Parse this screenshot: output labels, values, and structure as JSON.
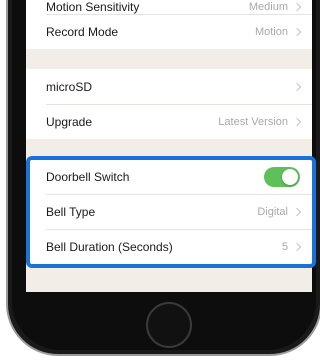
{
  "settings": {
    "cut_row": {
      "label": "Motion Sensitivity",
      "value": "Medium"
    },
    "record_mode": {
      "label": "Record Mode",
      "value": "Motion"
    },
    "microsd": {
      "label": "microSD",
      "value": ""
    },
    "upgrade": {
      "label": "Upgrade",
      "value": "Latest Version"
    },
    "doorbell_switch": {
      "label": "Doorbell Switch",
      "enabled": true
    },
    "bell_type": {
      "label": "Bell Type",
      "value": "Digital"
    },
    "bell_duration": {
      "label": "Bell Duration (Seconds)",
      "value": "5"
    }
  },
  "colors": {
    "highlight": "#1a72d9",
    "toggle_on": "#5fbf5a",
    "screen_background": "#f2eee7"
  },
  "icons": {
    "chevron": "chevron-right-icon"
  }
}
